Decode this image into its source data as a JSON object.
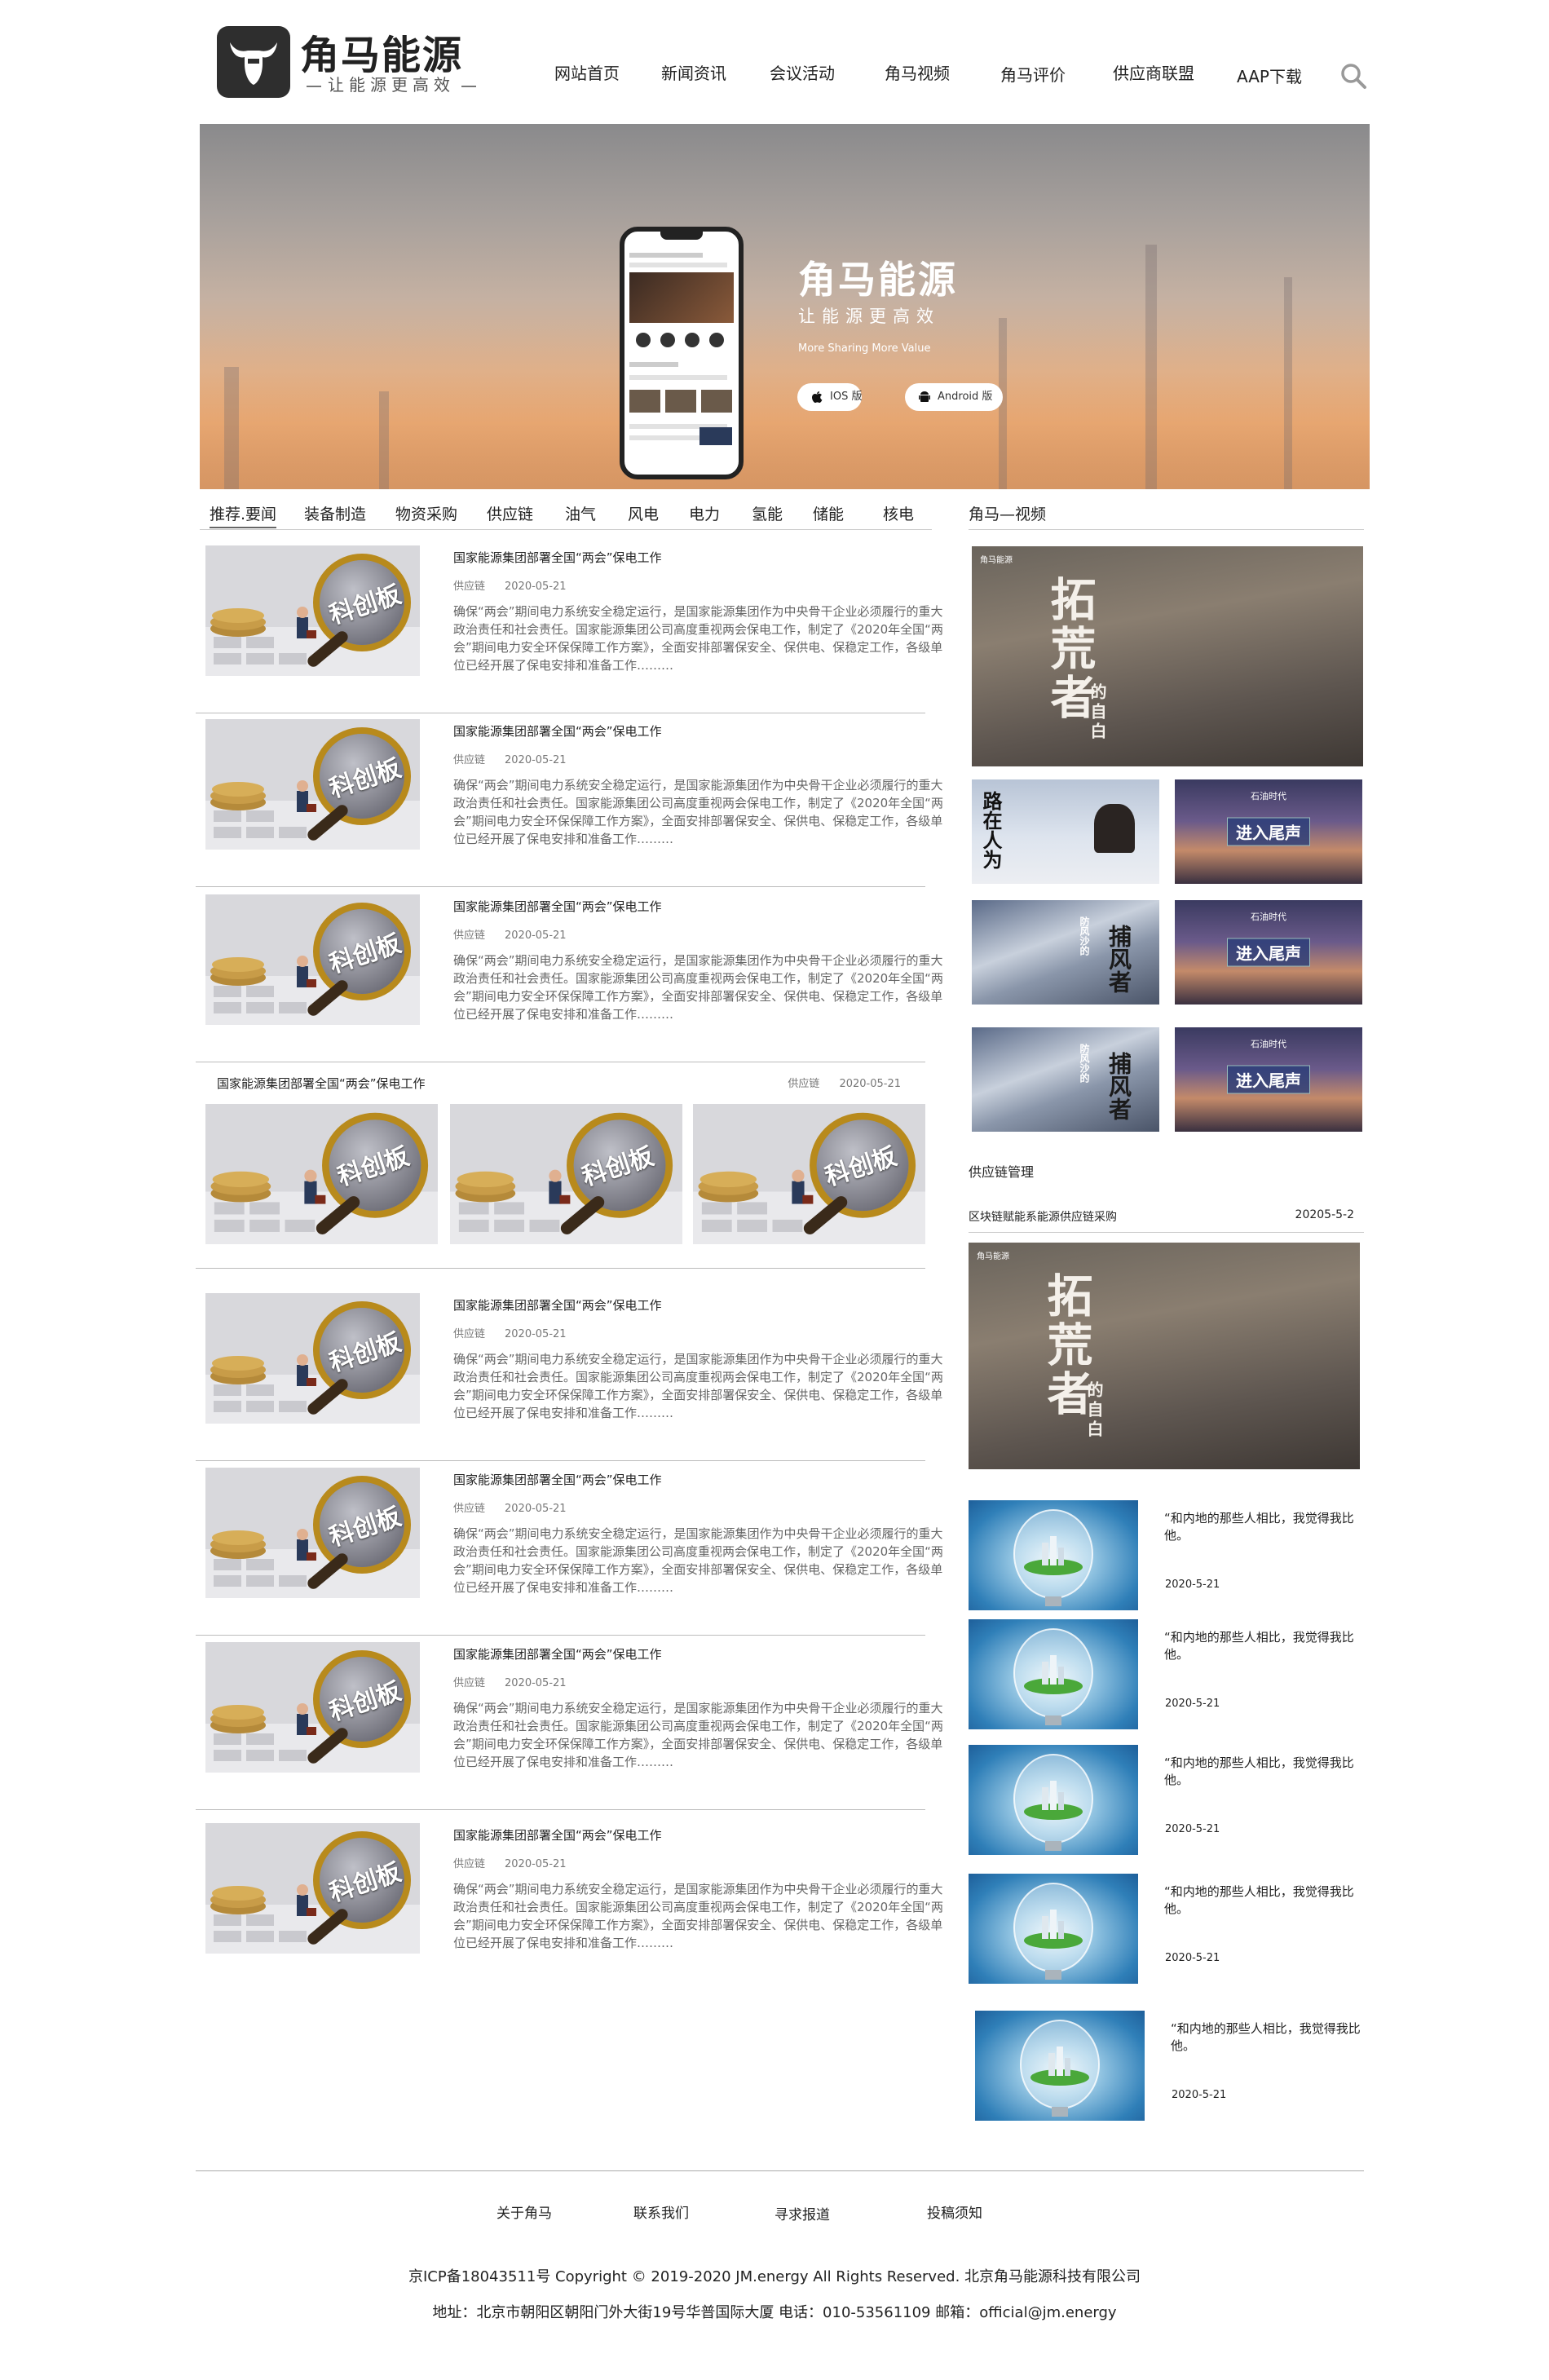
{
  "brand": {
    "name": "角马能源",
    "slogan": "让能源更高效"
  },
  "nav": {
    "items": [
      "网站首页",
      "新闻资讯",
      "会议活动",
      "角马视频",
      "角马评价",
      "供应商联盟",
      "AAP下载"
    ],
    "search_icon": "search-icon"
  },
  "banner": {
    "title": "角马能源",
    "slogan": "让能源更高效",
    "english": "More Sharing More Value",
    "ios_label": "IOS 版",
    "android_label": "Android 版"
  },
  "tabs": [
    "推荐.要闻",
    "装备制造",
    "物资采购",
    "供应链",
    "油气",
    "风电",
    "电力",
    "氢能",
    "储能",
    "核电"
  ],
  "article": {
    "title": "国家能源集团部署全国“两会”保电工作",
    "category": "供应链",
    "date": "2020-05-21",
    "summary": "确保“两会”期间电力系统安全稳定运行，是国家能源集团作为中央骨干企业必须履行的重大政治责任和社会责任。国家能源集团公司高度重视两会保电工作，制定了《2020年全国“两会”期间电力安全环保保障工作方案》，全面安排部署保安全、保供电、保稳定工作，各级单位已经开展了保电安排和准备工作………",
    "image_text": "科创板"
  },
  "sidebar": {
    "video_heading": "角马—视频",
    "video_brand": "角马能源",
    "video_titles": {
      "desert_big": "拓荒者",
      "desert_small": "的自白",
      "person": "路在人为",
      "oil_brand": "石油时代",
      "oil_title": "进入尾声",
      "snow": "捕风者",
      "snow_small": "防风沙的"
    },
    "supply_heading": "供应链管理",
    "supply_title": "区块链赋能系能源供应链采购",
    "supply_date": "20205-5-2",
    "quote_text": "“和内地的那些人相比，我觉得我比他。",
    "quote_date": "2020-5-21"
  },
  "footer": {
    "links": [
      "关于角马",
      "联系我们",
      "寻求报道",
      "投稿须知"
    ],
    "icp": "京ICP备18043511号 Copyright © 2019-2020 JM.energy All Rights Reserved. 北京角马能源科技有限公司",
    "address": "地址：北京市朝阳区朝阳门外大街19号华普国际大厦 电话：010-53561109 邮箱：official@jm.energy"
  },
  "colors": {
    "accent": "#2e2e2e",
    "divider": "#bbbbbb",
    "muted_text": "#666666"
  }
}
